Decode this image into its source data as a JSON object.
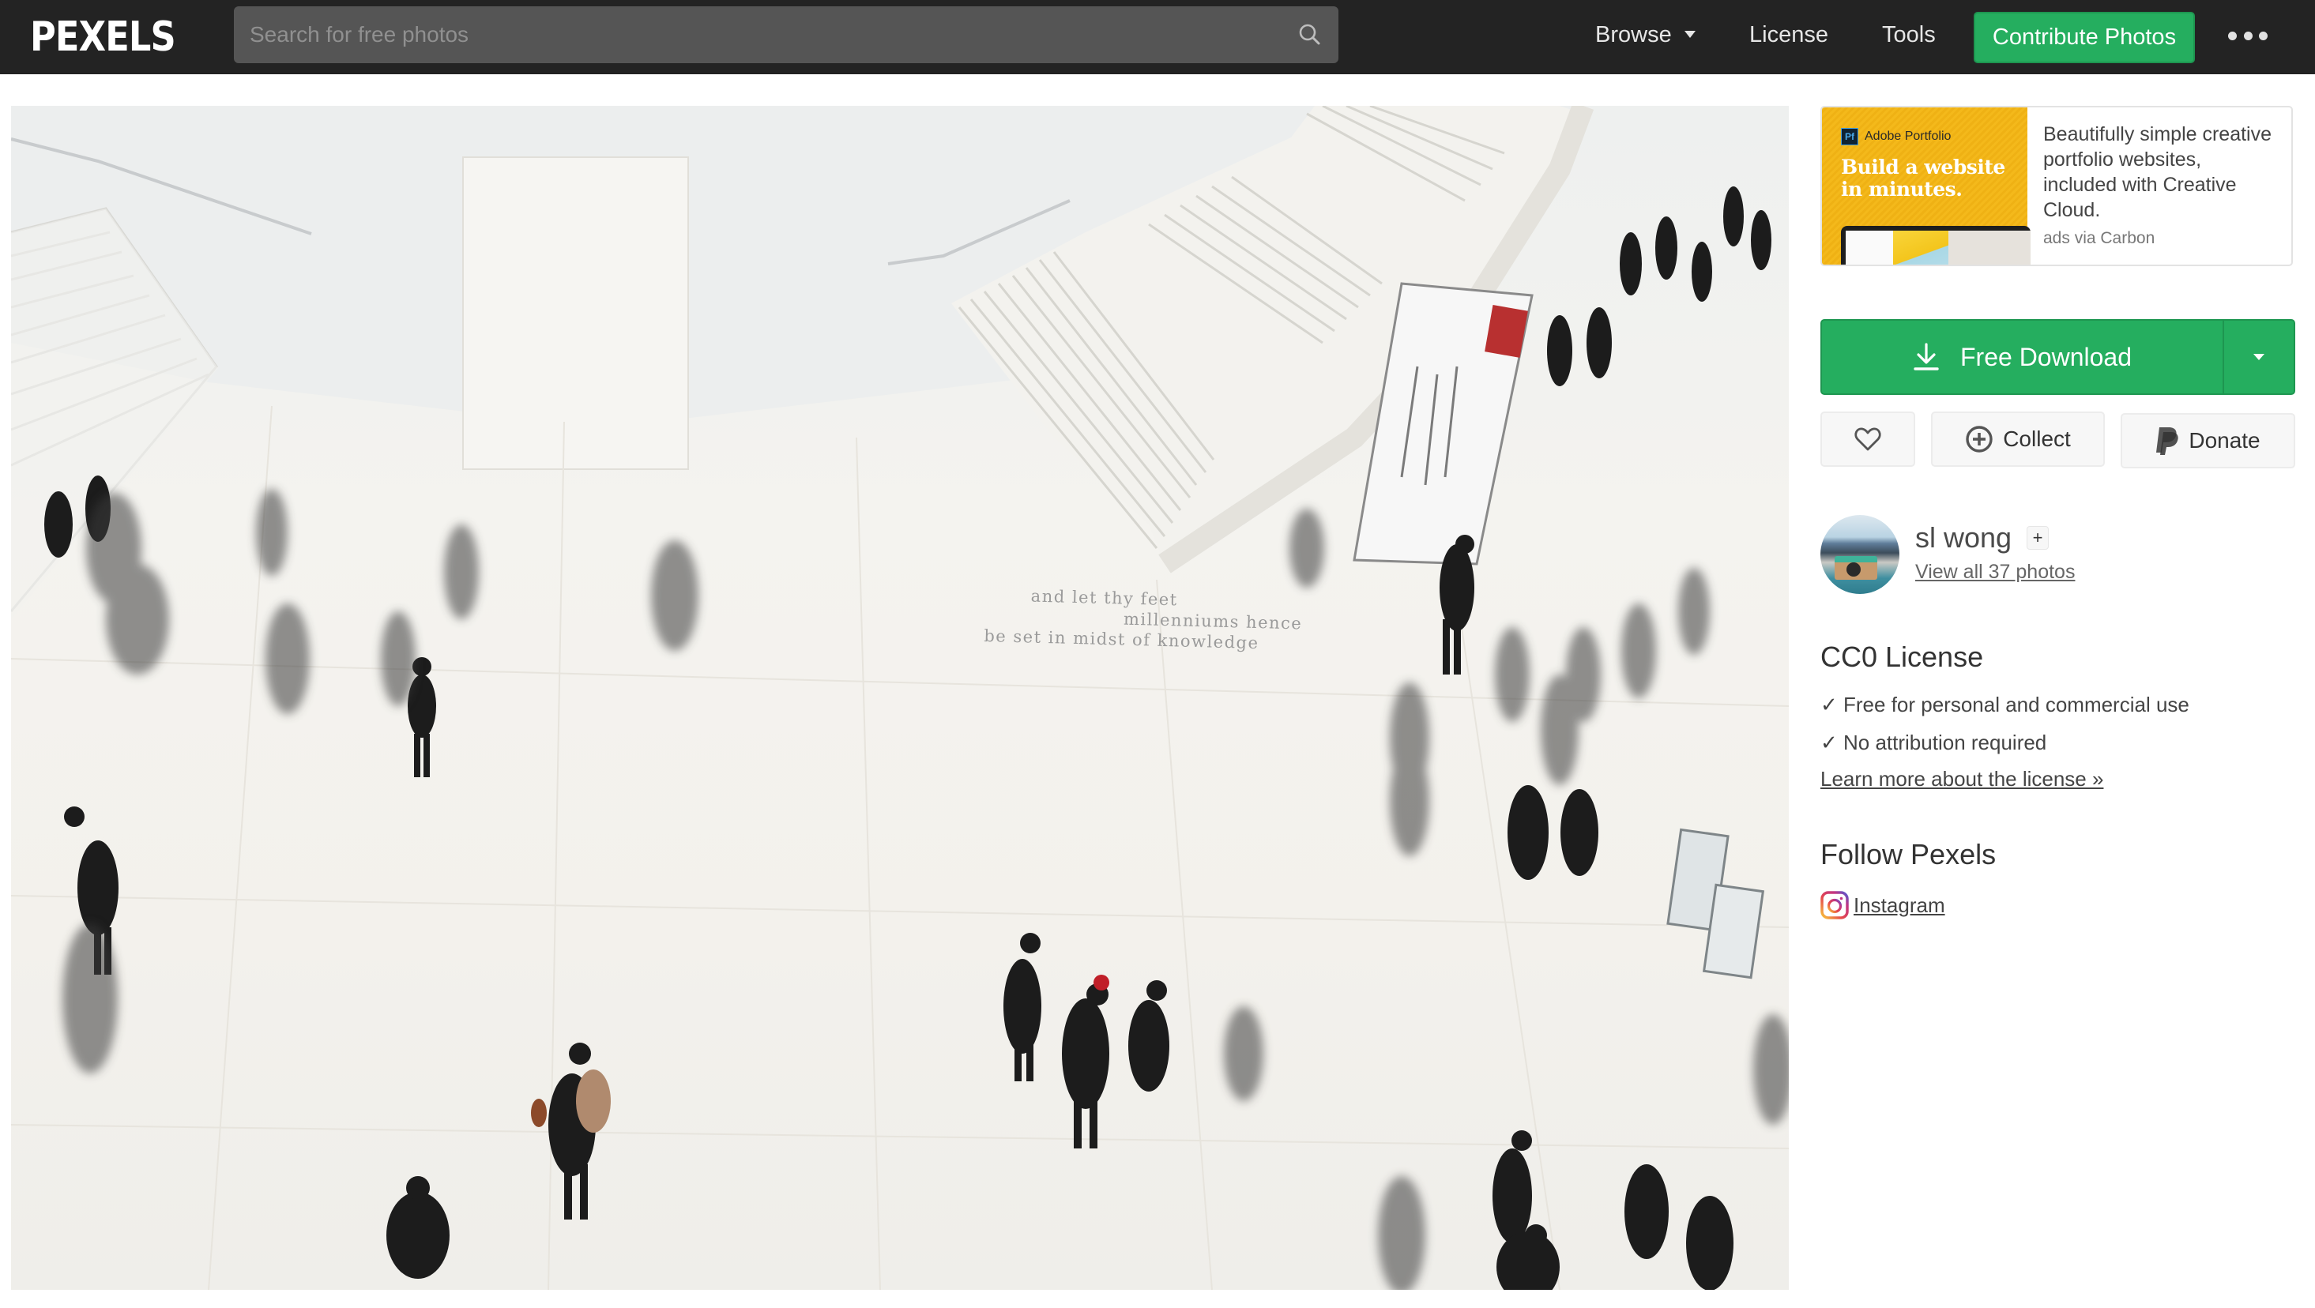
{
  "nav": {
    "logo": "PEXELS",
    "search_placeholder": "Search for free photos",
    "search_value": "",
    "search_icon": "search-icon",
    "links": [
      {
        "label": "Browse",
        "has_dropdown": true
      },
      {
        "label": "License"
      },
      {
        "label": "Tools"
      }
    ],
    "contribute_label": "Contribute Photos",
    "more_icon": "more-horizontal-icon",
    "accent_color": "#25ae5f",
    "background_color": "#232323"
  },
  "photo": {
    "description": "Overhead view of people walking across a bright marble museum atrium with staircases",
    "inscription": [
      "and let thy feet",
      "millenniums hence",
      "be set in midst of knowledge"
    ]
  },
  "ad": {
    "brand": "Adobe Portfolio",
    "brand_badge": "Pf",
    "headline_line1": "Build a website",
    "headline_line2": "in minutes.",
    "copy": "Beautifully simple creative portfolio websites, included with Creative Cloud.",
    "via": "ads via Carbon"
  },
  "actions": {
    "download_label": "Free Download",
    "download_icon": "download-icon",
    "download_dropdown_icon": "caret-down-icon",
    "like_icon": "heart-icon",
    "collect_label": "Collect",
    "collect_icon": "plus-circle-icon",
    "donate_label": "Donate",
    "donate_icon": "paypal-icon"
  },
  "author": {
    "name": "sl wong",
    "follow_label": "+",
    "view_all": "View all 37 photos",
    "photo_count": 37
  },
  "license": {
    "title": "CC0 License",
    "items": [
      "✓ Free for personal and commercial use",
      "✓ No attribution required"
    ],
    "learn_more": "Learn more about the license »"
  },
  "follow": {
    "title": "Follow Pexels",
    "instagram_label": "Instagram",
    "instagram_icon": "instagram-icon"
  }
}
